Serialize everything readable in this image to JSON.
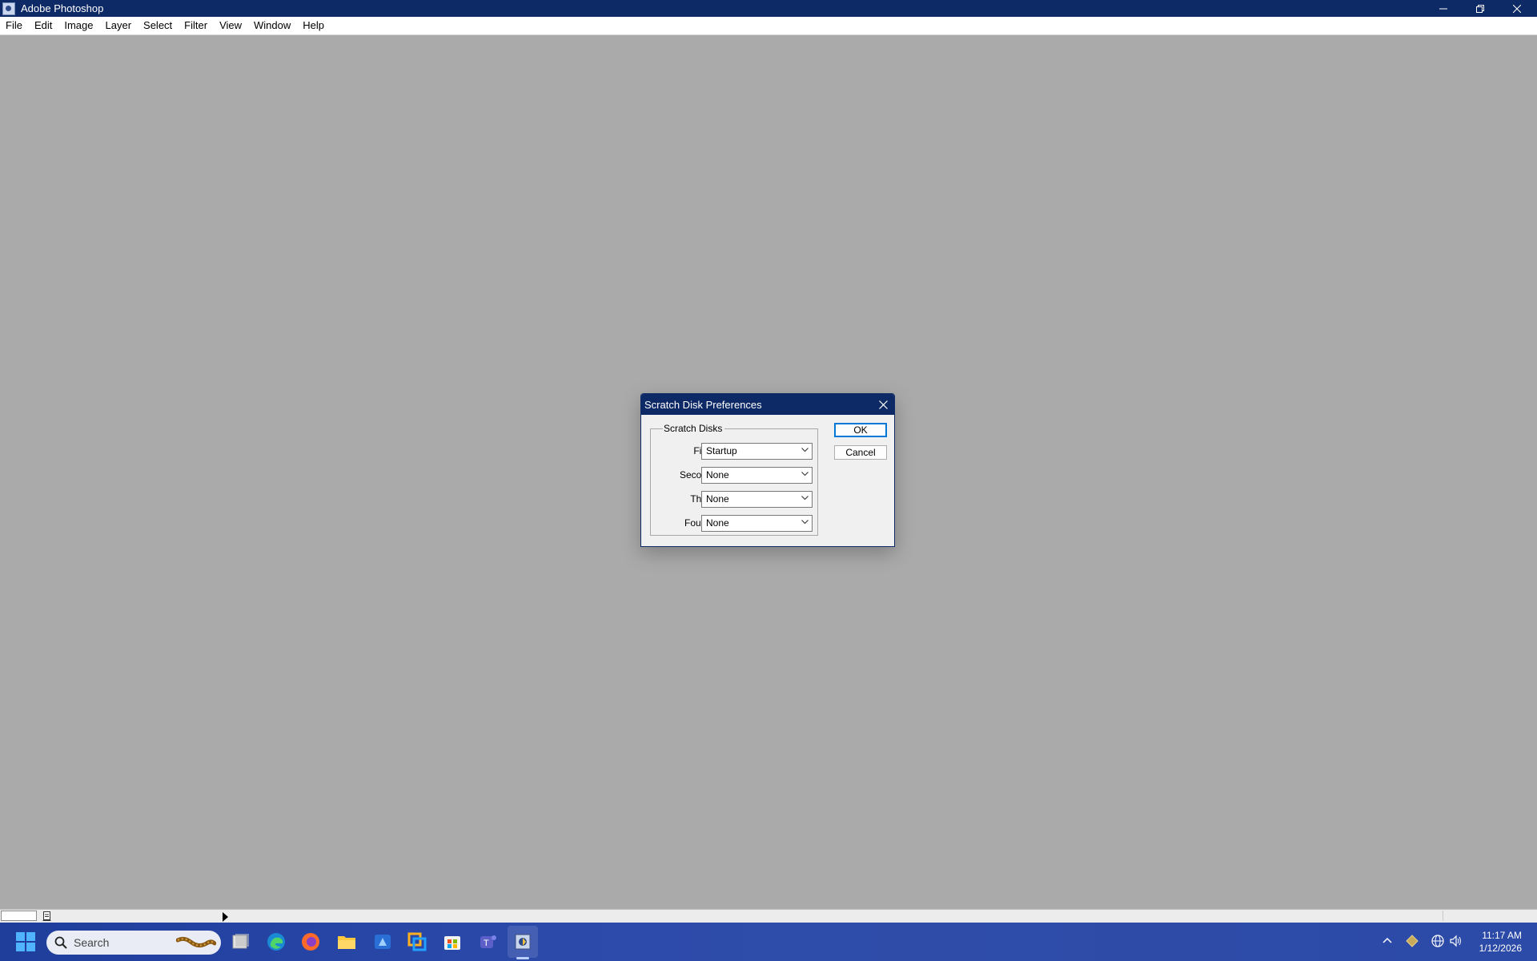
{
  "window": {
    "title": "Adobe Photoshop"
  },
  "menu": [
    "File",
    "Edit",
    "Image",
    "Layer",
    "Select",
    "Filter",
    "View",
    "Window",
    "Help"
  ],
  "dialog": {
    "title": "Scratch Disk Preferences",
    "group_label": "Scratch Disks",
    "rows": [
      {
        "label": "First:",
        "value": "Startup"
      },
      {
        "label": "Second:",
        "value": "None"
      },
      {
        "label": "Third:",
        "value": "None"
      },
      {
        "label": "Fourth:",
        "value": "None"
      }
    ],
    "ok_label": "OK",
    "cancel_label": "Cancel"
  },
  "taskbar": {
    "search_placeholder": "Search",
    "time": "11:17 AM",
    "date": "1/12/2026"
  },
  "colors": {
    "titlebar": "#0e2a66",
    "workspace": "#aaaaaa",
    "dialog_bg": "#f0f0f0",
    "default_button_border": "#0078d7"
  }
}
